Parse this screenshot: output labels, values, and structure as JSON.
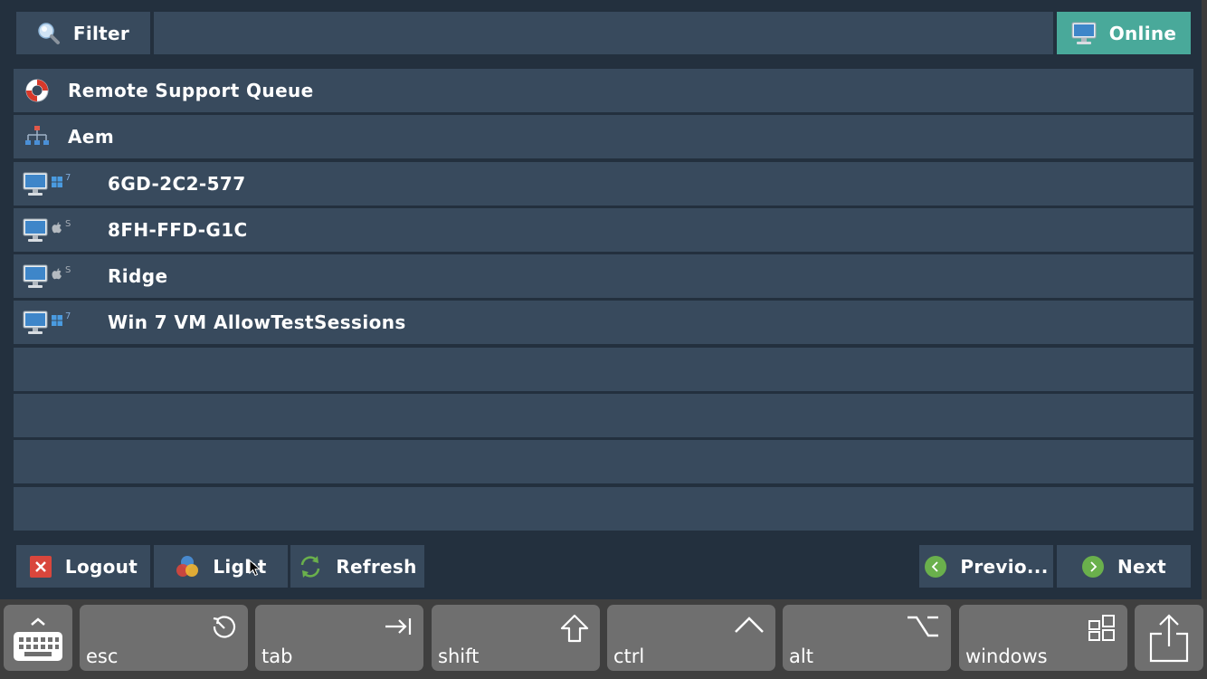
{
  "topbar": {
    "filter_label": "Filter",
    "filter_icon": "magnifier-icon",
    "filter_value": "",
    "online_label": "Online",
    "online_icon": "monitor-icon"
  },
  "list": {
    "groups": [
      {
        "label": "Remote Support Queue",
        "icon": "lifebuoy-icon"
      },
      {
        "label": "Aem",
        "icon": "hierarchy-icon"
      }
    ],
    "devices": [
      {
        "label": "6GD-2C2-577",
        "os": "windows",
        "os_version": "7"
      },
      {
        "label": "8FH-FFD-G1C",
        "os": "mac",
        "os_version": "S"
      },
      {
        "label": "Ridge",
        "os": "mac",
        "os_version": "S"
      },
      {
        "label": "Win 7 VM AllowTestSessions",
        "os": "windows",
        "os_version": "7"
      }
    ]
  },
  "bottombar": {
    "logout_label": "Logout",
    "light_label": "Light",
    "refresh_label": "Refresh",
    "previous_label": "Previo...",
    "next_label": "Next"
  },
  "keyboard": {
    "esc_label": "esc",
    "tab_label": "tab",
    "shift_label": "shift",
    "ctrl_label": "ctrl",
    "alt_label": "alt",
    "windows_label": "windows"
  },
  "colors": {
    "background": "#23303e",
    "panel": "#384a5d",
    "accent_online": "#49a99a",
    "logout_red": "#d9463c",
    "nav_green": "#6ab04c",
    "keyboard_bg": "#3f3f3f",
    "key_bg": "#6f6f6f"
  }
}
